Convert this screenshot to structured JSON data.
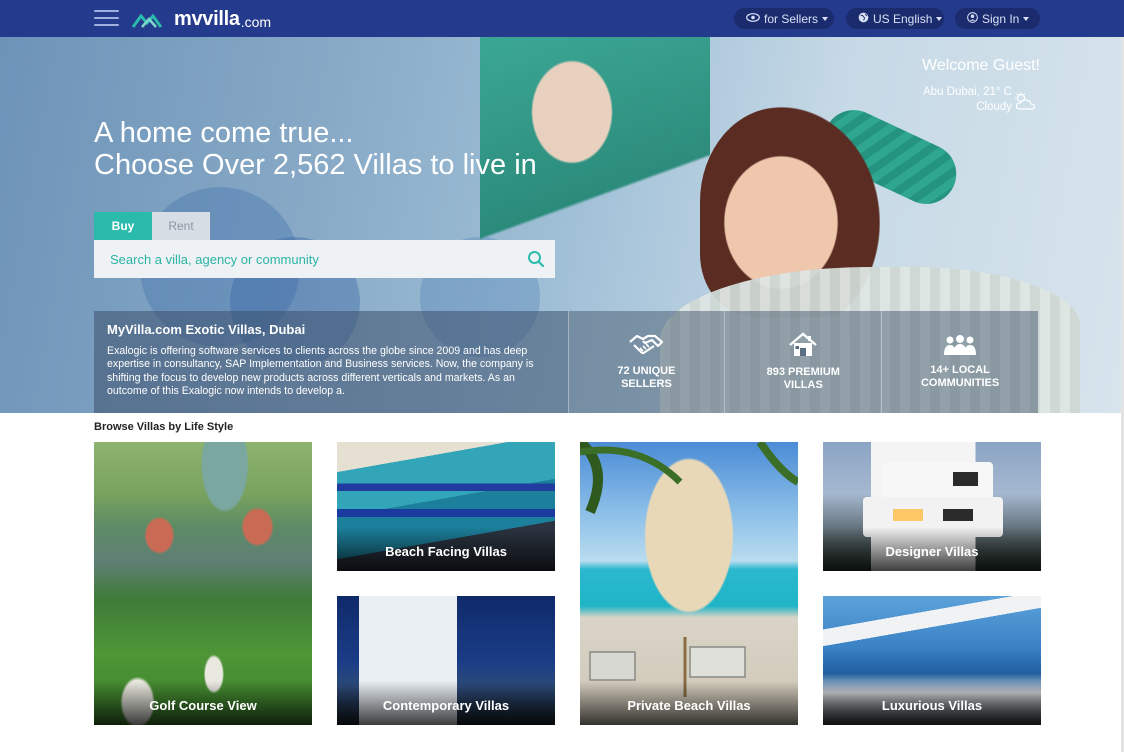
{
  "header": {
    "brand": "mvvilla",
    "tld": ".com",
    "sellers_label": "for Sellers",
    "language_label": "US English",
    "signin_label": "Sign In"
  },
  "hero": {
    "welcome": "Welcome Guest!",
    "weather_line1": "Abu Dubai, 21° C",
    "weather_line2": "Cloudy",
    "headline_line1": "A home come true...",
    "headline_line2": "Choose Over 2,562 Villas to live in"
  },
  "search": {
    "tabs": [
      "Buy",
      "Rent"
    ],
    "placeholder": "Search a villa, agency or community"
  },
  "info": {
    "title": "MyVilla.com Exotic Villas, Dubai",
    "body": "Exalogic is offering software services to clients across the globe since 2009 and has deep expertise in consultancy, SAP Implementation and Business services. Now, the company is shifting the focus to develop new products across different verticals and markets. As an outcome of this Exalogic now intends to develop a."
  },
  "stats": [
    {
      "line1": "72 UNIQUE",
      "line2": "SELLERS",
      "icon": "handshake-icon"
    },
    {
      "line1": "893 PREMIUM",
      "line2": "VILLAS",
      "icon": "house-icon"
    },
    {
      "line1": "14+ LOCAL",
      "line2": "COMMUNITIES",
      "icon": "people-icon"
    }
  ],
  "browse": {
    "title": "Browse Villas by Life Style",
    "tiles": [
      {
        "label": "Golf Course View"
      },
      {
        "label": "Beach Facing Villas"
      },
      {
        "label": "Private Beach Villas"
      },
      {
        "label": "Designer Villas"
      },
      {
        "label": "Contemporary Villas"
      },
      {
        "label": "Luxurious Villas"
      }
    ]
  },
  "colors": {
    "nav": "#243a8c",
    "accent": "#2bbbad"
  }
}
